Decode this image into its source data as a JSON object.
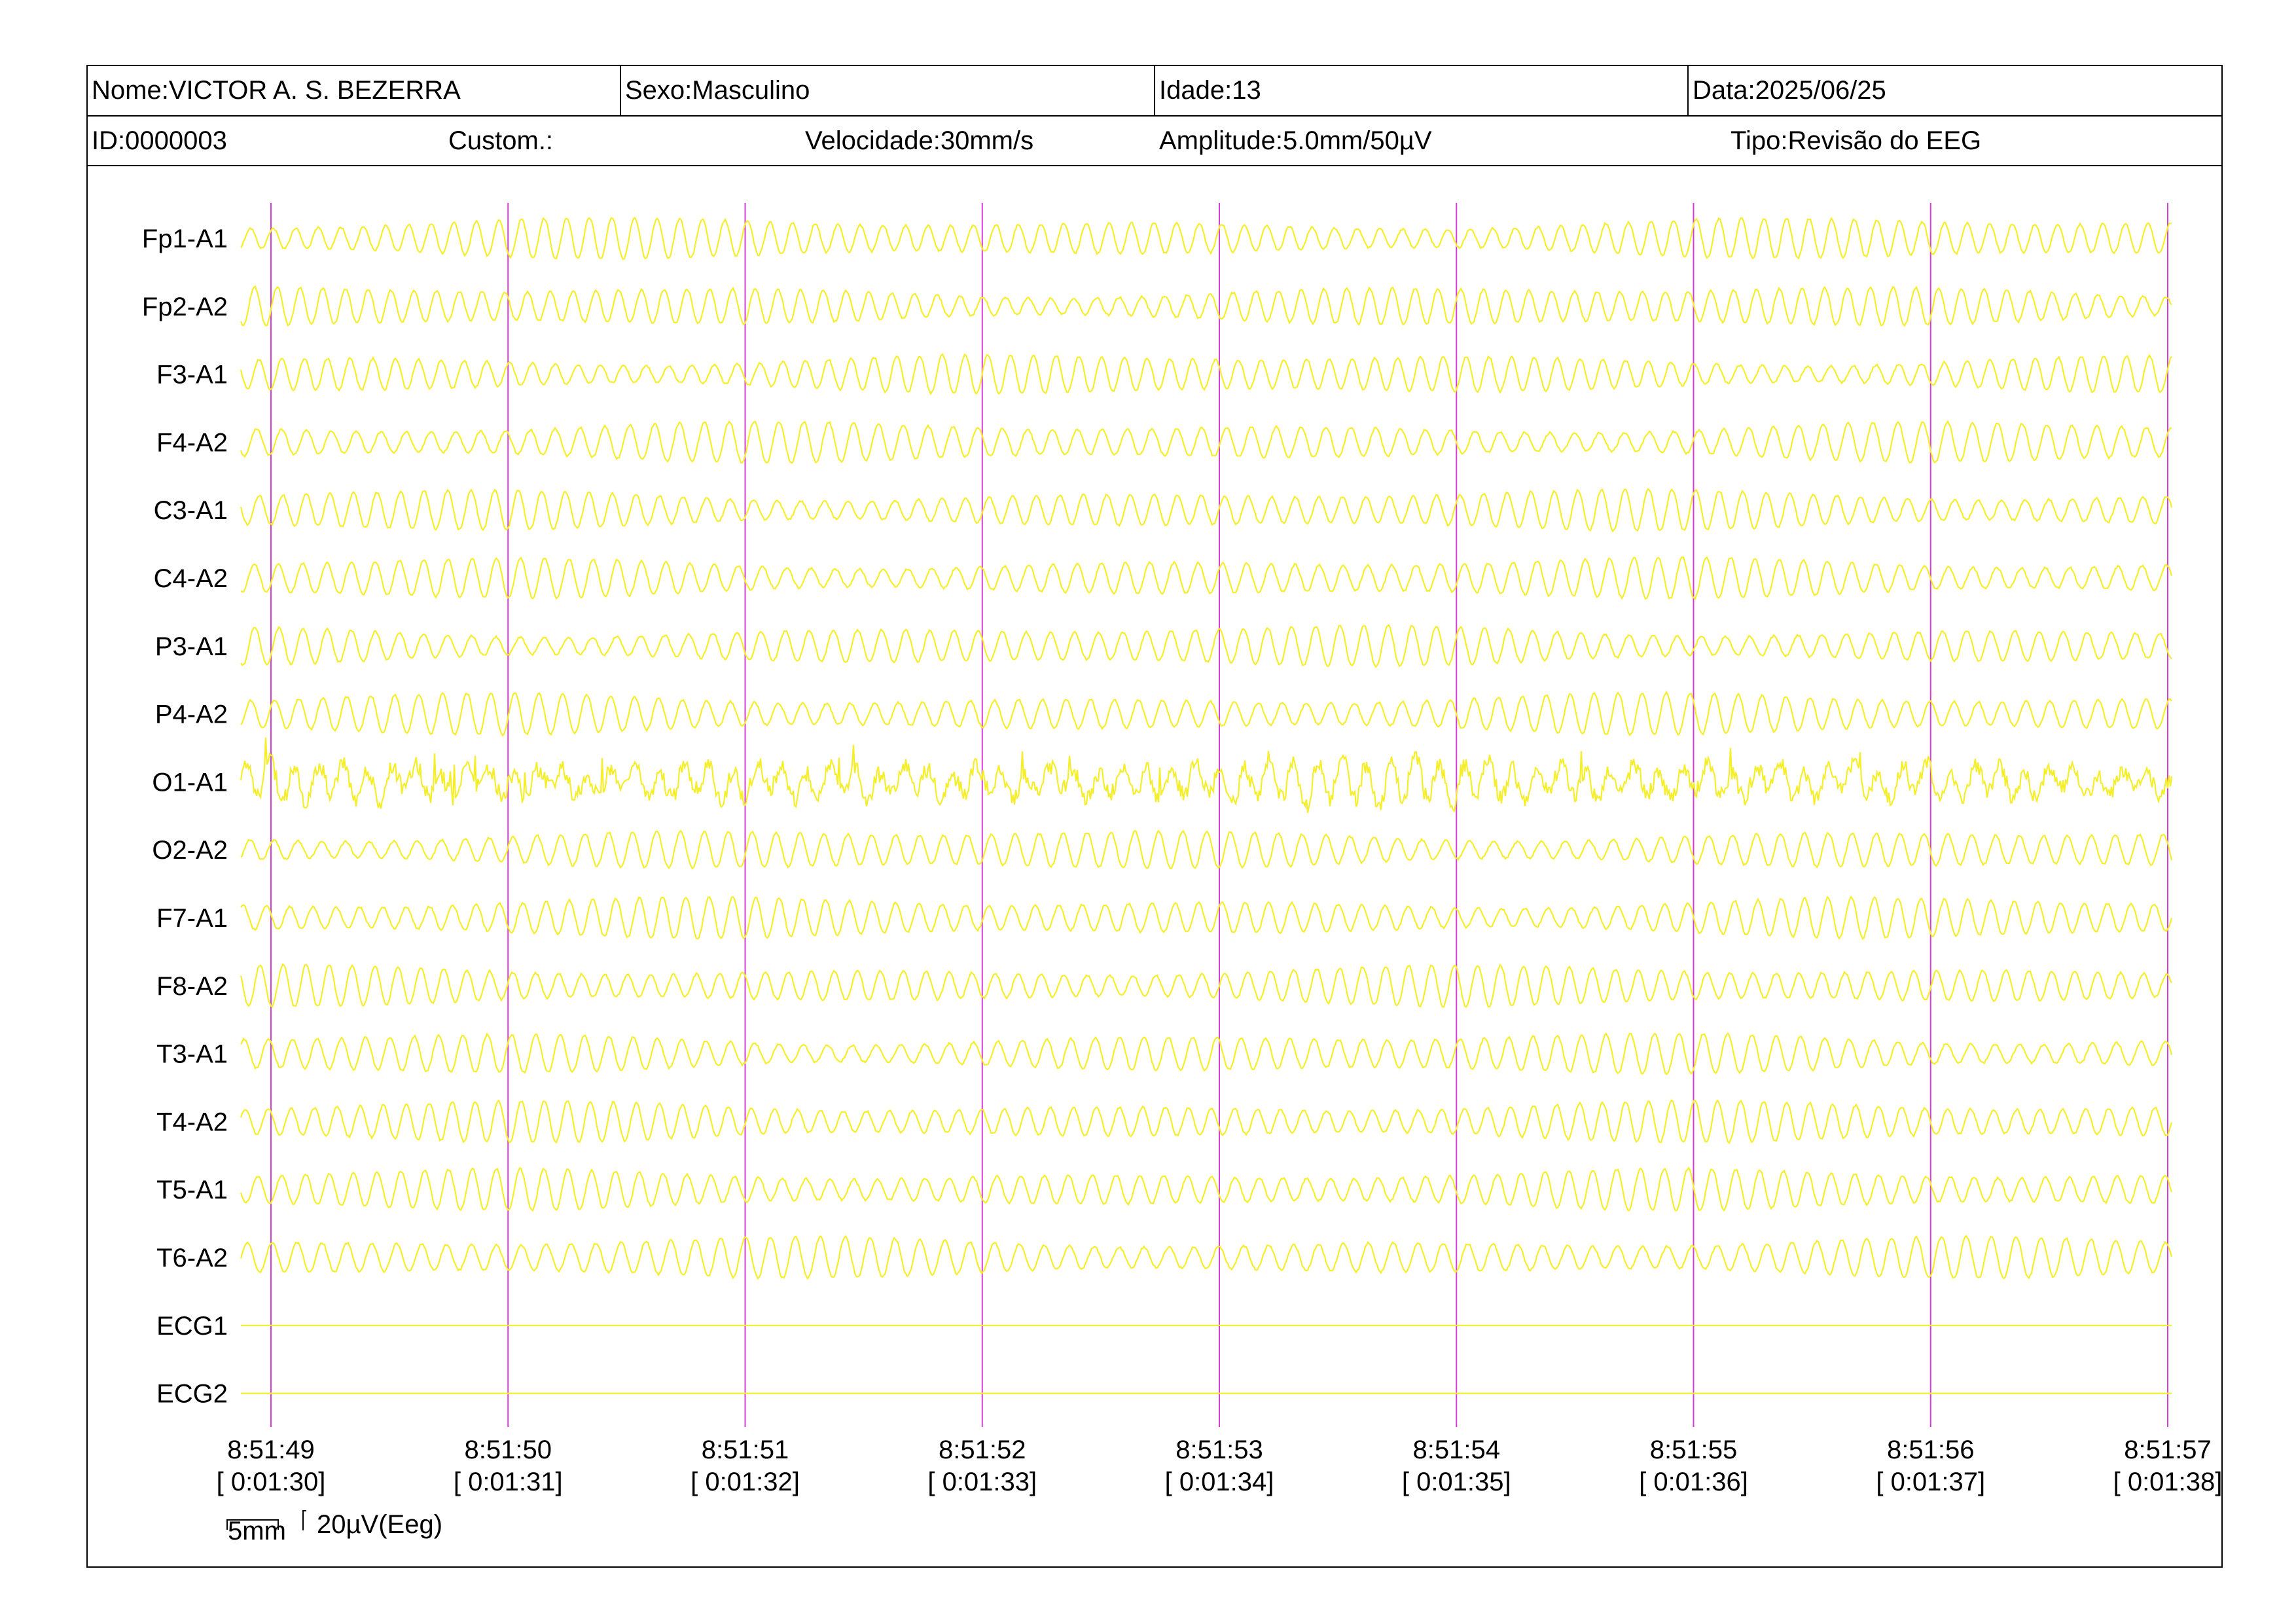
{
  "header": {
    "nome": "Nome:VICTOR A. S. BEZERRA",
    "sexo": "Sexo:Masculino",
    "idade": "Idade:13",
    "data": "Data:2025/06/25",
    "id": "ID:0000003",
    "custom": "Custom.:",
    "velocidade": "Velocidade:30mm/s",
    "amplitude": "Amplitude:5.0mm/50µV",
    "tipo": "Tipo:Revisão do EEG"
  },
  "scale_bar": {
    "time_label": "5mm",
    "amp_label": "20µV(Eeg)"
  },
  "colors": {
    "trace": "#f5ee2a",
    "marker": "#d63cd6",
    "frame": "#000000"
  },
  "chart_data": {
    "type": "line",
    "channels": [
      "Fp1-A1",
      "Fp2-A2",
      "F3-A1",
      "F4-A2",
      "C3-A1",
      "C4-A2",
      "P3-A1",
      "P4-A2",
      "O1-A1",
      "O2-A2",
      "F7-A1",
      "F8-A2",
      "T3-A1",
      "T4-A2",
      "T5-A1",
      "T6-A2",
      "ECG1",
      "ECG2"
    ],
    "time_ticks": [
      {
        "clock": "8:51:49",
        "elapsed": "[ 0:01:30]"
      },
      {
        "clock": "8:51:50",
        "elapsed": "[ 0:01:31]"
      },
      {
        "clock": "8:51:51",
        "elapsed": "[ 0:01:32]"
      },
      {
        "clock": "8:51:52",
        "elapsed": "[ 0:01:33]"
      },
      {
        "clock": "8:51:53",
        "elapsed": "[ 0:01:34]"
      },
      {
        "clock": "8:51:54",
        "elapsed": "[ 0:01:35]"
      },
      {
        "clock": "8:51:55",
        "elapsed": "[ 0:01:36]"
      },
      {
        "clock": "8:51:56",
        "elapsed": "[ 0:01:37]"
      },
      {
        "clock": "8:51:57",
        "elapsed": "[ 0:01:38]"
      }
    ],
    "seconds_shown": 8,
    "dominant_frequency_hz": 10,
    "flat_channels": [
      "ECG1",
      "ECG2"
    ],
    "artifact_channels": [
      "O1-A1"
    ]
  }
}
